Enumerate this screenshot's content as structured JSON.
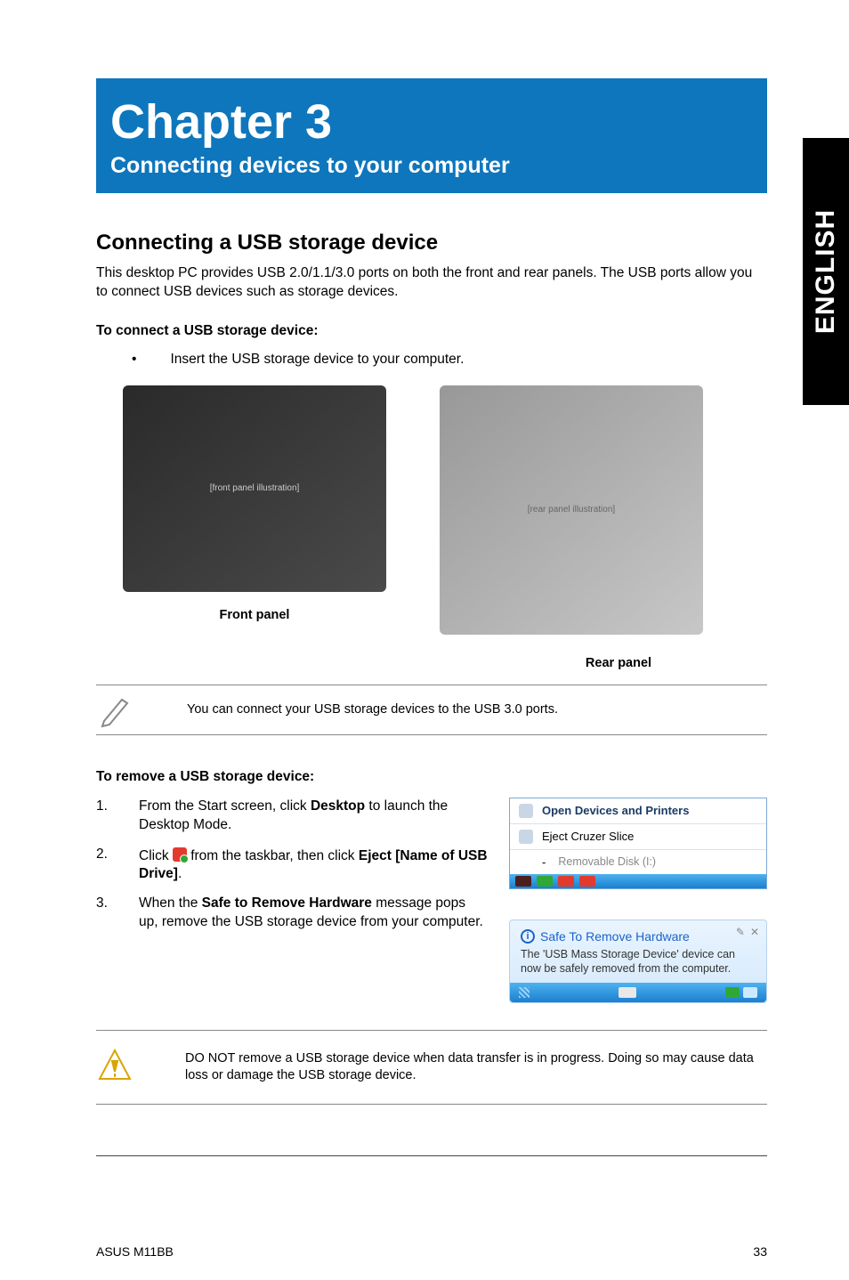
{
  "sideTab": "ENGLISH",
  "chapter": {
    "title": "Chapter 3",
    "subtitle": "Connecting devices to your computer"
  },
  "section": {
    "heading": "Connecting a USB storage device",
    "intro": "This desktop PC provides USB 2.0/1.1/3.0 ports on both the front and rear panels. The USB ports allow you to connect USB devices such as storage devices.",
    "connectHeading": "To connect a USB storage device:",
    "connectBullet": "Insert the USB storage device to your computer.",
    "frontCaption": "Front panel",
    "rearCaption": "Rear panel",
    "noteText": "You can connect your USB storage devices to the USB 3.0 ports.",
    "removeHeading": "To remove a USB storage device:",
    "steps": [
      {
        "num": "1.",
        "pre": "From the Start screen, click ",
        "bold1": "Desktop",
        "post": " to launch the Desktop Mode."
      },
      {
        "num": "2.",
        "pre": "Click ",
        "mid": " from the taskbar, then click ",
        "bold1": "Eject [Name of USB Drive]",
        "post": "."
      },
      {
        "num": "3.",
        "pre": "When the ",
        "bold1": "Safe to Remove Hardware",
        "post": " message pops up, remove the USB storage device from your computer."
      }
    ],
    "popup1": {
      "line1": "Open Devices and Printers",
      "line2": "Eject Cruzer Slice",
      "line3": "Removable Disk (I:)"
    },
    "popup2": {
      "title": "Safe To Remove Hardware",
      "msg": "The 'USB Mass Storage Device' device can now be safely removed from the computer."
    },
    "warning": "DO NOT remove a USB storage device when data transfer is in progress. Doing so may cause data loss or damage the USB storage device."
  },
  "footer": {
    "left": "ASUS M11BB",
    "right": "33"
  }
}
